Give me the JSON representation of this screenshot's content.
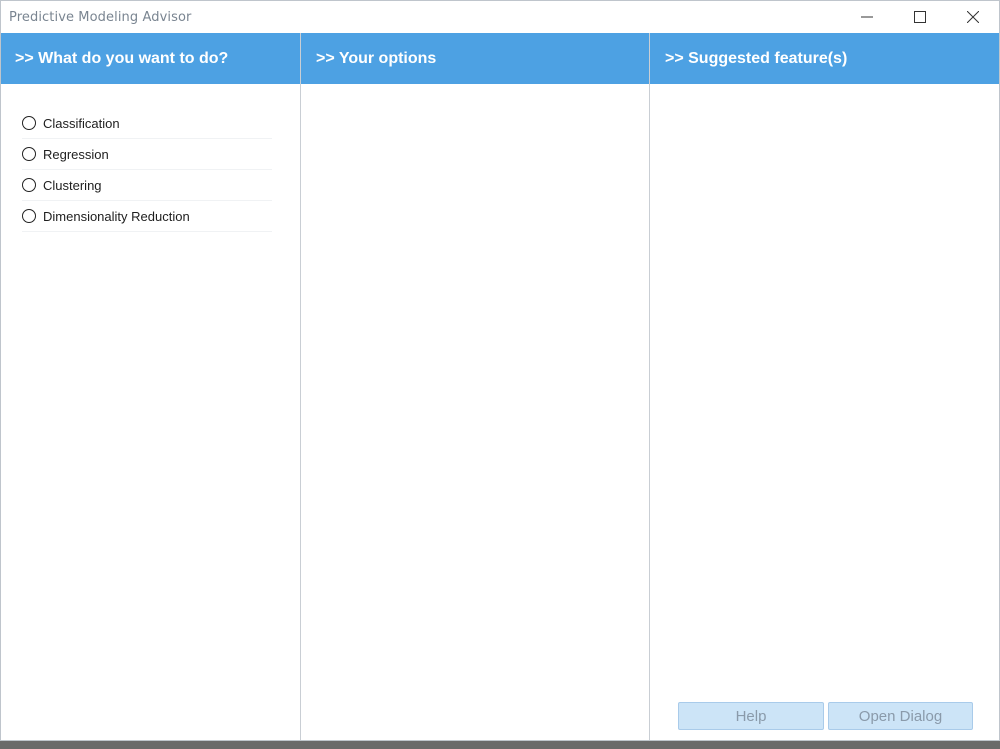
{
  "window": {
    "title": "Predictive Modeling Advisor",
    "controls": {
      "minimize": "minimize-icon",
      "maximize": "maximize-icon",
      "close": "close-icon"
    }
  },
  "columns": {
    "col1": {
      "header": ">> What do you want to do?",
      "options": [
        {
          "label": "Classification",
          "selected": false
        },
        {
          "label": "Regression",
          "selected": false
        },
        {
          "label": "Clustering",
          "selected": false
        },
        {
          "label": "Dimensionality Reduction",
          "selected": false
        }
      ]
    },
    "col2": {
      "header": ">> Your options"
    },
    "col3": {
      "header": ">> Suggested feature(s)"
    }
  },
  "buttons": {
    "help": "Help",
    "open_dialog": "Open Dialog"
  },
  "colors": {
    "header_bg": "#4da1e3",
    "button_bg": "#cce4f7",
    "button_text": "#8a9aaa"
  }
}
